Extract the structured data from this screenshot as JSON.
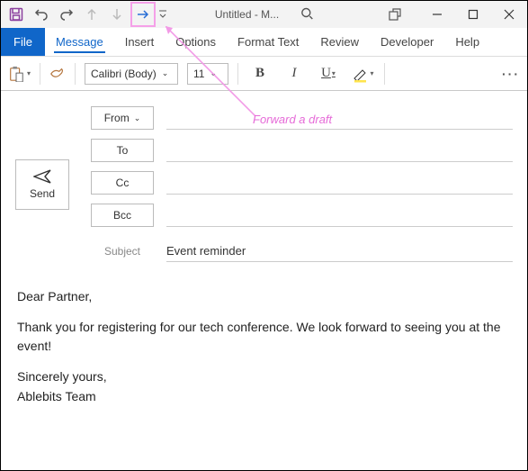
{
  "titlebar": {
    "title": "Untitled  -  M..."
  },
  "qat": {
    "save": "save",
    "undo": "undo",
    "redo": "redo",
    "up": "up",
    "down": "down",
    "forward": "forward"
  },
  "tabs": {
    "file": "File",
    "message": "Message",
    "insert": "Insert",
    "options": "Options",
    "formattext": "Format Text",
    "review": "Review",
    "developer": "Developer",
    "help": "Help"
  },
  "ribbon": {
    "fontname": "Calibri (Body)",
    "fontsize": "11",
    "bold": "B",
    "italic": "I",
    "underline": "U",
    "more": "···"
  },
  "envelope": {
    "send": "Send",
    "from": "From",
    "to": "To",
    "cc": "Cc",
    "bcc": "Bcc",
    "subject_label": "Subject",
    "subject_value": "Event reminder"
  },
  "body": {
    "p1": "Dear Partner,",
    "p2": "Thank you for registering for our tech conference. We look forward to seeing you at the event!",
    "p3": "Sincerely yours,",
    "p4": "Ablebits Team"
  },
  "annotation": {
    "text": "Forward a draft"
  }
}
